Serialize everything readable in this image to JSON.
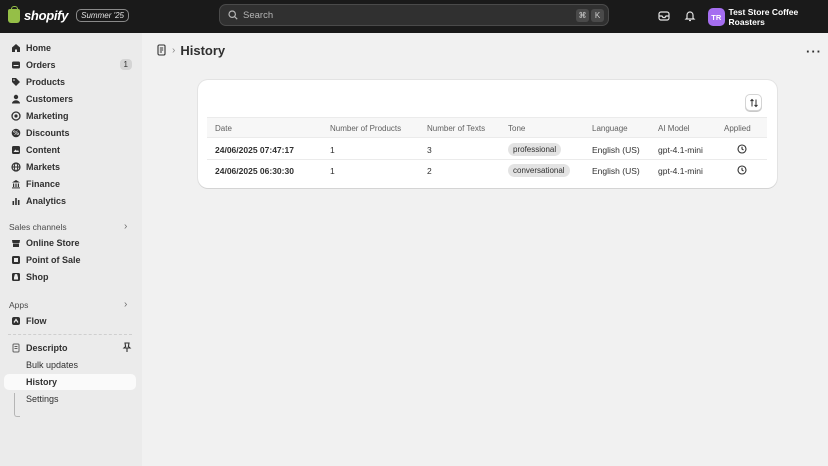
{
  "topbar": {
    "logo_text": "shopify",
    "edition_badge": "Summer '25",
    "search_placeholder": "Search",
    "shortcut_keys": [
      "⌘",
      "K"
    ],
    "store_initials": "TR",
    "store_name": "Test Store Coffee Roasters",
    "avatar_color": "#a56ef0"
  },
  "sidebar": {
    "main_items": [
      {
        "label": "Home",
        "icon": "home-icon"
      },
      {
        "label": "Orders",
        "icon": "orders-icon",
        "count": "1"
      },
      {
        "label": "Products",
        "icon": "tag-icon"
      },
      {
        "label": "Customers",
        "icon": "person-icon"
      },
      {
        "label": "Marketing",
        "icon": "target-icon"
      },
      {
        "label": "Discounts",
        "icon": "discount-icon"
      },
      {
        "label": "Content",
        "icon": "content-icon"
      },
      {
        "label": "Markets",
        "icon": "globe-icon"
      },
      {
        "label": "Finance",
        "icon": "bank-icon"
      },
      {
        "label": "Analytics",
        "icon": "chart-icon"
      }
    ],
    "sales_channels_label": "Sales channels",
    "sales_channels": [
      {
        "label": "Online Store",
        "icon": "store-icon"
      },
      {
        "label": "Point of Sale",
        "icon": "pos-icon"
      },
      {
        "label": "Shop",
        "icon": "shop-icon"
      }
    ],
    "apps_label": "Apps",
    "apps": [
      {
        "label": "Flow",
        "icon": "flow-icon"
      }
    ],
    "app_name": "Descripto",
    "app_subitems": [
      "Bulk updates",
      "History",
      "Settings"
    ]
  },
  "page": {
    "title": "History"
  },
  "table": {
    "headers": [
      "Date",
      "Number of Products",
      "Number of Texts",
      "Tone",
      "Language",
      "AI Model",
      "Applied"
    ],
    "rows": [
      {
        "date": "24/06/2025 07:47:17",
        "products": "1",
        "texts": "3",
        "tone": "professional",
        "language": "English (US)",
        "model": "gpt-4.1-mini"
      },
      {
        "date": "24/06/2025 06:30:30",
        "products": "1",
        "texts": "2",
        "tone": "conversational",
        "language": "English (US)",
        "model": "gpt-4.1-mini"
      }
    ]
  }
}
